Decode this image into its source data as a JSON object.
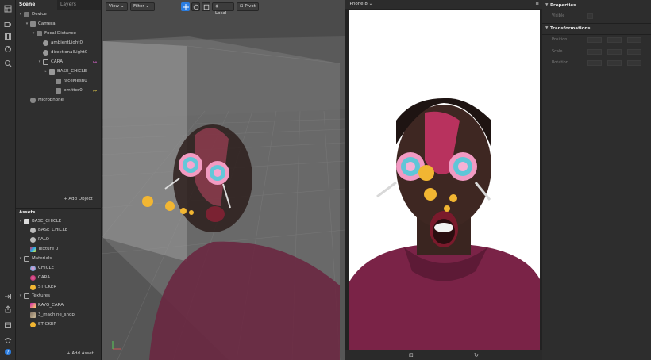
{
  "colors": {
    "accent": "#2a7de1",
    "marker_pink": "#d462c8",
    "marker_yellow": "#d9c34a"
  },
  "scene_panel": {
    "tabs": [
      "Scene",
      "Layers"
    ],
    "tree": [
      {
        "label": "Device",
        "icon": "device-icon"
      },
      {
        "label": "Camera",
        "icon": "camera-icon"
      },
      {
        "label": "Focal Distance",
        "icon": "focal-distance-icon"
      },
      {
        "label": "ambientLight0",
        "icon": "light-icon"
      },
      {
        "label": "directionalLight0",
        "icon": "light-icon"
      },
      {
        "label": "CARA",
        "icon": "face-tracker-icon"
      },
      {
        "label": "BASE_CHICLE",
        "icon": "3d-object-icon"
      },
      {
        "label": "faceMesh0",
        "icon": "face-mesh-icon"
      },
      {
        "label": "emitter0",
        "icon": "emitter-icon"
      },
      {
        "label": "Microphone",
        "icon": "microphone-icon"
      }
    ],
    "add_object": "Add Object"
  },
  "assets_panel": {
    "title": "Assets",
    "tree": [
      {
        "label": "BASE_CHICLE",
        "icon": "model-file-icon"
      },
      {
        "label": "BASE_CHICLE",
        "icon": "mesh-icon"
      },
      {
        "label": "PALO",
        "icon": "mesh-icon"
      },
      {
        "label": "Texture 0",
        "icon": "texture-icon"
      },
      {
        "label": "Materials",
        "icon": "folder-icon"
      },
      {
        "label": "CHICLE",
        "icon": "material-icon"
      },
      {
        "label": "CARA",
        "icon": "material-icon"
      },
      {
        "label": "STICKER",
        "icon": "emoji-material-icon"
      },
      {
        "label": "Textures",
        "icon": "folder-icon"
      },
      {
        "label": "RAYO_CARA",
        "icon": "texture-icon"
      },
      {
        "label": "3_machine_shop",
        "icon": "texture-icon"
      },
      {
        "label": "STICKER",
        "icon": "emoji-texture-icon"
      }
    ],
    "add_asset": "Add Asset"
  },
  "viewport": {
    "view_label": "View",
    "filter_label": "Filter",
    "local_label": "Local",
    "pivot_label": "Pivot"
  },
  "simulator": {
    "device": "iPhone 8"
  },
  "properties": {
    "section_properties": "Properties",
    "visible_label": "Visible",
    "section_transformations": "Transformations",
    "position_label": "Position",
    "scale_label": "Scale",
    "rotation_label": "Rotation"
  }
}
